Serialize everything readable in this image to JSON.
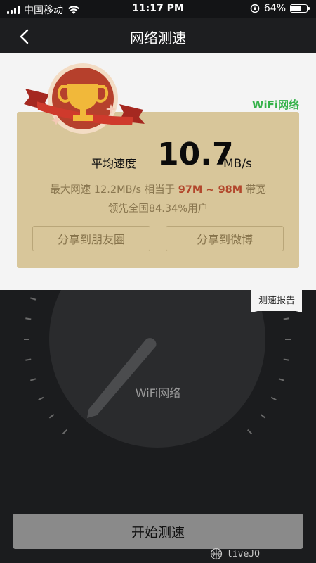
{
  "status_bar": {
    "carrier": "中国移动",
    "time": "11:17 PM",
    "battery": "64%",
    "battery_level": 0.64
  },
  "nav": {
    "title": "网络测速",
    "back_icon": "chevron-left-icon"
  },
  "result": {
    "network_type": "WiFi网络",
    "avg_label": "平均速度",
    "speed_value": "10.7",
    "speed_unit": "MB/s",
    "line1_prefix": "最大网速 12.2MB/s 相当于 ",
    "line1_highlight": "97M ~ 98M",
    "line1_suffix": " 带宽",
    "line2": "领先全国84.34%用户",
    "share_moments": "分享到朋友圈",
    "share_weibo": "分享到微博",
    "trophy_icon": "trophy-icon"
  },
  "report_tab": "测速报告",
  "gauge": {
    "label": "WiFi网络"
  },
  "start_button": "开始测速",
  "watermark": "liveJQ",
  "colors": {
    "accent_green": "#35b24a",
    "card_bg": "#d8c69a",
    "highlight_red": "#b2472c"
  }
}
